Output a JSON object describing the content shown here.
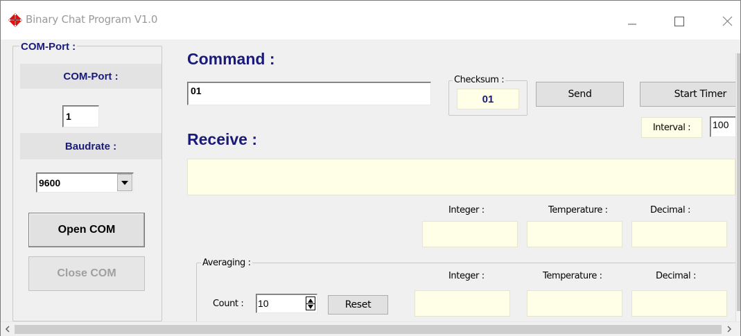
{
  "window": {
    "title": "Binary Chat Program V1.0",
    "icon": "red-diamond-cross-icon",
    "controls": [
      "minimize-icon",
      "maximize-icon",
      "close-icon"
    ]
  },
  "com_port_group": {
    "legend": "COM-Port :",
    "com_port_label": "COM-Port :",
    "com_port_value": "1",
    "baudrate_label": "Baudrate :",
    "baudrate_selected": "9600",
    "open_button": "Open COM",
    "close_button": "Close COM"
  },
  "command": {
    "heading": "Command :",
    "value": "01",
    "checksum_legend": "Checksum :",
    "checksum_value": "01",
    "send_button": "Send",
    "start_timer_button": "Start Timer",
    "interval_label": "Interval :",
    "interval_value": "100"
  },
  "receive": {
    "heading": "Receive :",
    "value": "",
    "integer_label": "Integer :",
    "temperature_label": "Temperature :",
    "decimal_label": "Decimal :"
  },
  "averaging": {
    "legend": "Averaging :",
    "count_label": "Count :",
    "count_value": "10",
    "reset_button": "Reset",
    "integer_label": "Integer :",
    "temperature_label": "Temperature :",
    "decimal_label": "Decimal :"
  },
  "colors": {
    "heading": "#1a1a7a",
    "readout_background": "#ffffe7",
    "window_background": "#f0f0f0",
    "icon_red": "#e01010"
  }
}
